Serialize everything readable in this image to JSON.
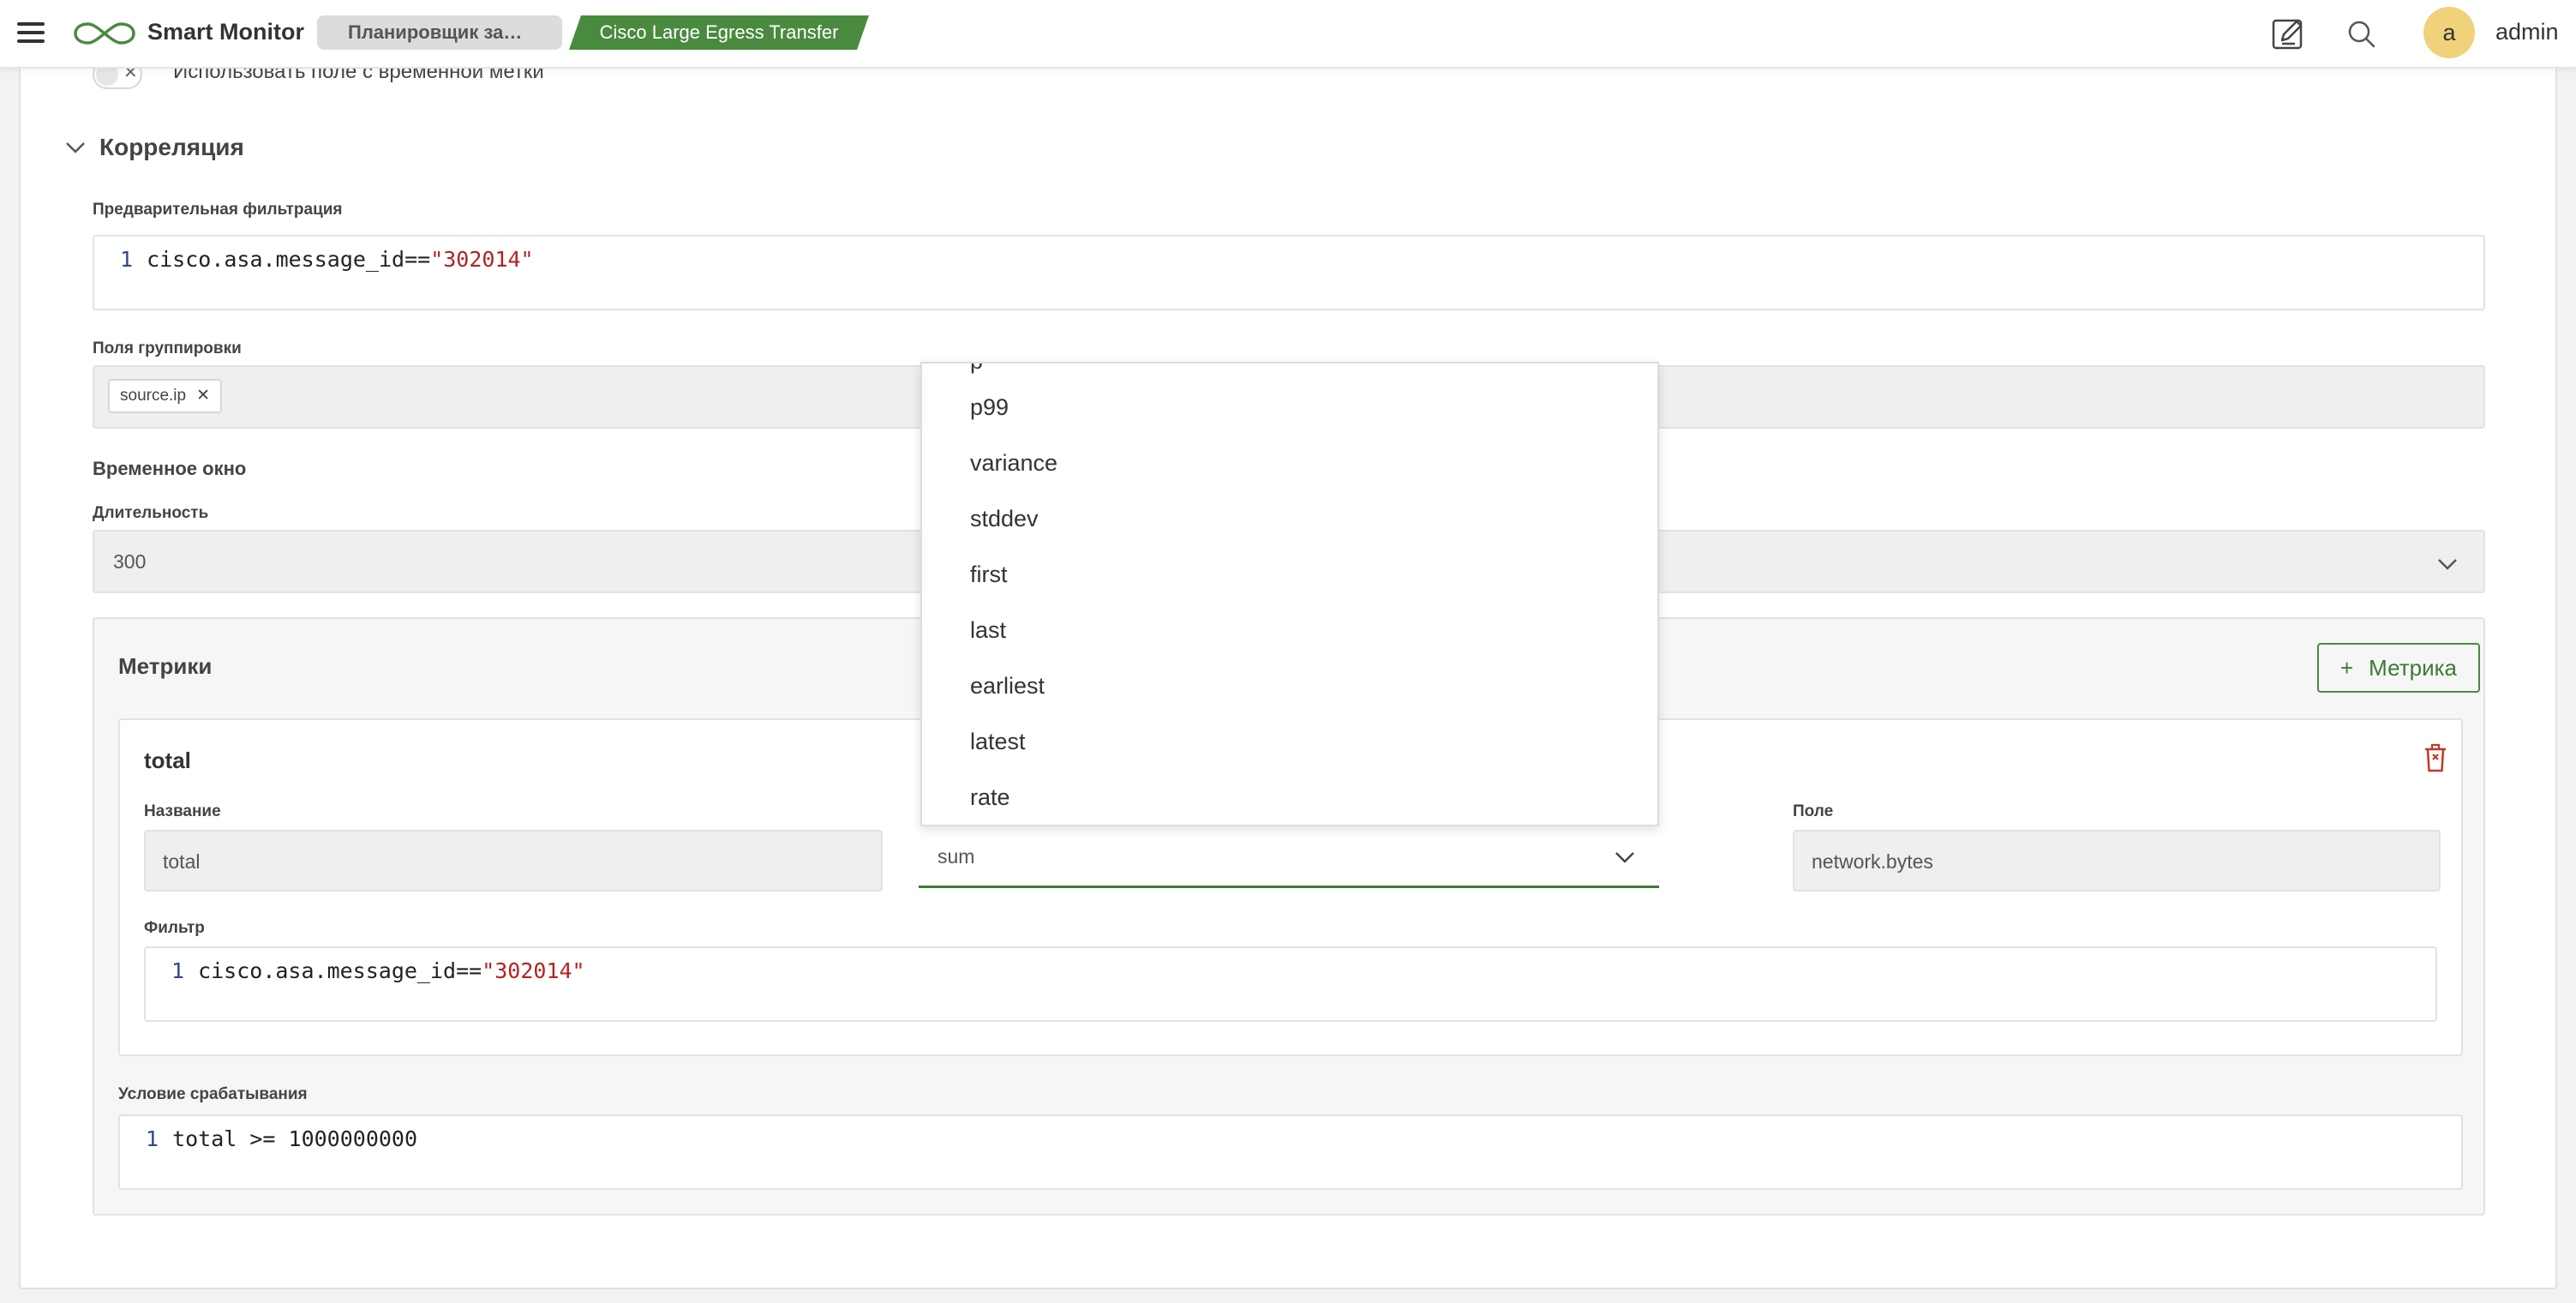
{
  "topbar": {
    "app_name": "Smart Monitor",
    "tabs": [
      {
        "label": "Планировщик задач"
      },
      {
        "label": "Cisco Large Egress Transfer"
      }
    ],
    "avatar_letter": "a",
    "username": "admin",
    "icons": [
      "menu-icon",
      "logo-icon",
      "edit-icon",
      "search-icon"
    ]
  },
  "form": {
    "timestamp_toggle_label": "Использовать поле с временной метки",
    "correlation": {
      "title": "Корреляция",
      "prefilter": {
        "label": "Предварительная фильтрация",
        "line_no": "1",
        "code_prefix": "cisco.asa.message_id==",
        "code_string": "\"302014\""
      },
      "grouping": {
        "label": "Поля группировки",
        "chips": [
          "source.ip"
        ]
      },
      "time_window": {
        "title": "Временное окно",
        "duration_label": "Длительность",
        "duration_value": "300"
      },
      "metrics": {
        "title": "Метрики",
        "add_button": "Метрика",
        "items": [
          {
            "title": "total",
            "name_label": "Название",
            "name_value": "total",
            "function_value": "sum",
            "field_label": "Поле",
            "field_value": "network.bytes",
            "filter_label": "Фильтр",
            "filter_line_no": "1",
            "filter_code_prefix": "cisco.asa.message_id==",
            "filter_code_string": "\"302014\""
          }
        ]
      },
      "trigger": {
        "label": "Условие срабатывания",
        "line_no": "1",
        "code": "total >= 1000000000"
      }
    }
  },
  "function_dropdown": {
    "partial_top": "p",
    "options": [
      "p99",
      "variance",
      "stddev",
      "first",
      "last",
      "earliest",
      "latest",
      "rate"
    ]
  },
  "colors": {
    "accent_green": "#4a8a3f",
    "delete_red": "#c0392b",
    "string_red": "#b22323",
    "line_number_blue": "#2f4a8a"
  }
}
